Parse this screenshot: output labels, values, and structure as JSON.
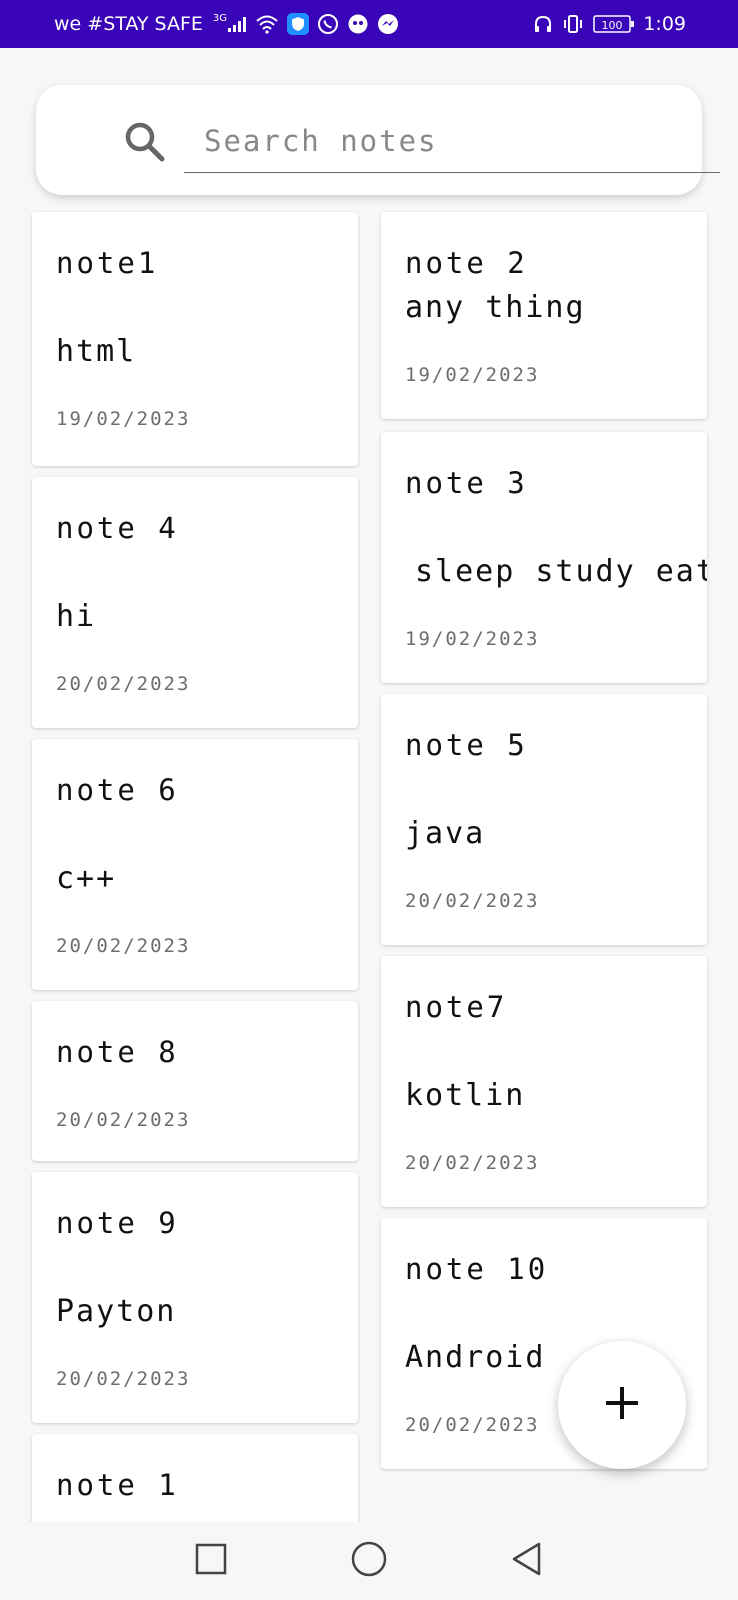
{
  "status_bar": {
    "carrier": "we #STAY SAFE",
    "network": "3G",
    "battery": "100",
    "time": "1:09",
    "icons": [
      "signal-icon",
      "wifi-icon",
      "vpn-shield-icon",
      "whatsapp-icon",
      "game-icon",
      "messenger-icon",
      "headphones-icon",
      "vibrate-icon",
      "battery-icon"
    ]
  },
  "search": {
    "placeholder": "Search notes",
    "icon": "search-icon"
  },
  "notes": [
    {
      "title": "note1",
      "body": "html",
      "date": "19/02/2023"
    },
    {
      "title": "note 2",
      "body": "any thing",
      "date": "19/02/2023"
    },
    {
      "title": "note 4",
      "body": "hi",
      "date": "20/02/2023"
    },
    {
      "title": "note 3",
      "body": "sleep study eat",
      "date": "19/02/2023"
    },
    {
      "title": "note 6",
      "body": "c++",
      "date": "20/02/2023"
    },
    {
      "title": "note 5",
      "body": "java",
      "date": "20/02/2023"
    },
    {
      "title": "note 8",
      "body": "",
      "date": "20/02/2023"
    },
    {
      "title": "note7",
      "body": "kotlin",
      "date": "20/02/2023"
    },
    {
      "title": "note 9",
      "body": "Payton",
      "date": "20/02/2023"
    },
    {
      "title": "note 10",
      "body": "Android",
      "date": "20/02/2023"
    },
    {
      "title": "note 1",
      "body": "",
      "date": ""
    }
  ],
  "fab": {
    "icon": "plus-icon"
  },
  "nav_bar": {
    "icons": [
      "recents-square-icon",
      "home-circle-icon",
      "back-triangle-icon"
    ]
  }
}
